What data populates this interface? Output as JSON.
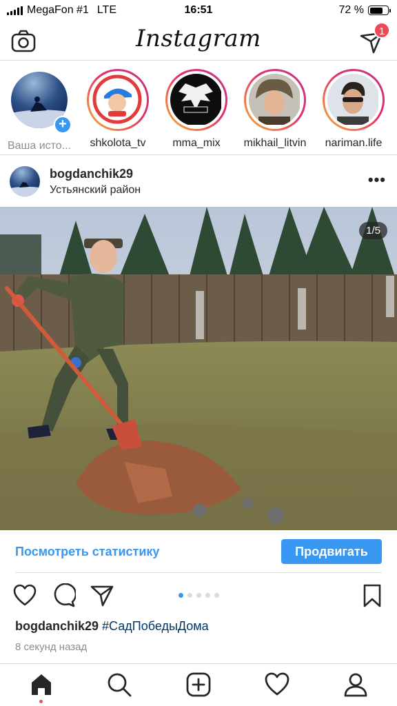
{
  "status_bar": {
    "carrier": "MegaFon #1",
    "network": "LTE",
    "time": "16:51",
    "battery_text": "72 %",
    "battery_level": 0.72
  },
  "header": {
    "logo_text": "Instagram",
    "camera_icon": "camera-icon",
    "direct_icon": "direct-message-icon",
    "direct_badge": "1",
    "badge_color": "#ed4956"
  },
  "stories": [
    {
      "name": "Ваша исто...",
      "own": true
    },
    {
      "name": "shkolota_tv"
    },
    {
      "name": "mma_mix"
    },
    {
      "name": "mikhail_litvin"
    },
    {
      "name": "nariman.life"
    }
  ],
  "post": {
    "username": "bogdanchik29",
    "location": "Устьянский район",
    "more_icon": "more-options-icon",
    "counter": "1/5",
    "stats_link": "Посмотреть статистику",
    "promote_label": "Продвигать",
    "caption_user": "bogdanchik29",
    "caption_hashtag": "#СадПобедыДома",
    "time_ago": "8 секунд назад",
    "carousel_total": 5,
    "carousel_active": 1,
    "accent_color": "#3897f0"
  },
  "tabbar": {
    "items": [
      "home-icon",
      "search-icon",
      "new-post-icon",
      "activity-heart-icon",
      "profile-icon"
    ],
    "active": "home"
  }
}
